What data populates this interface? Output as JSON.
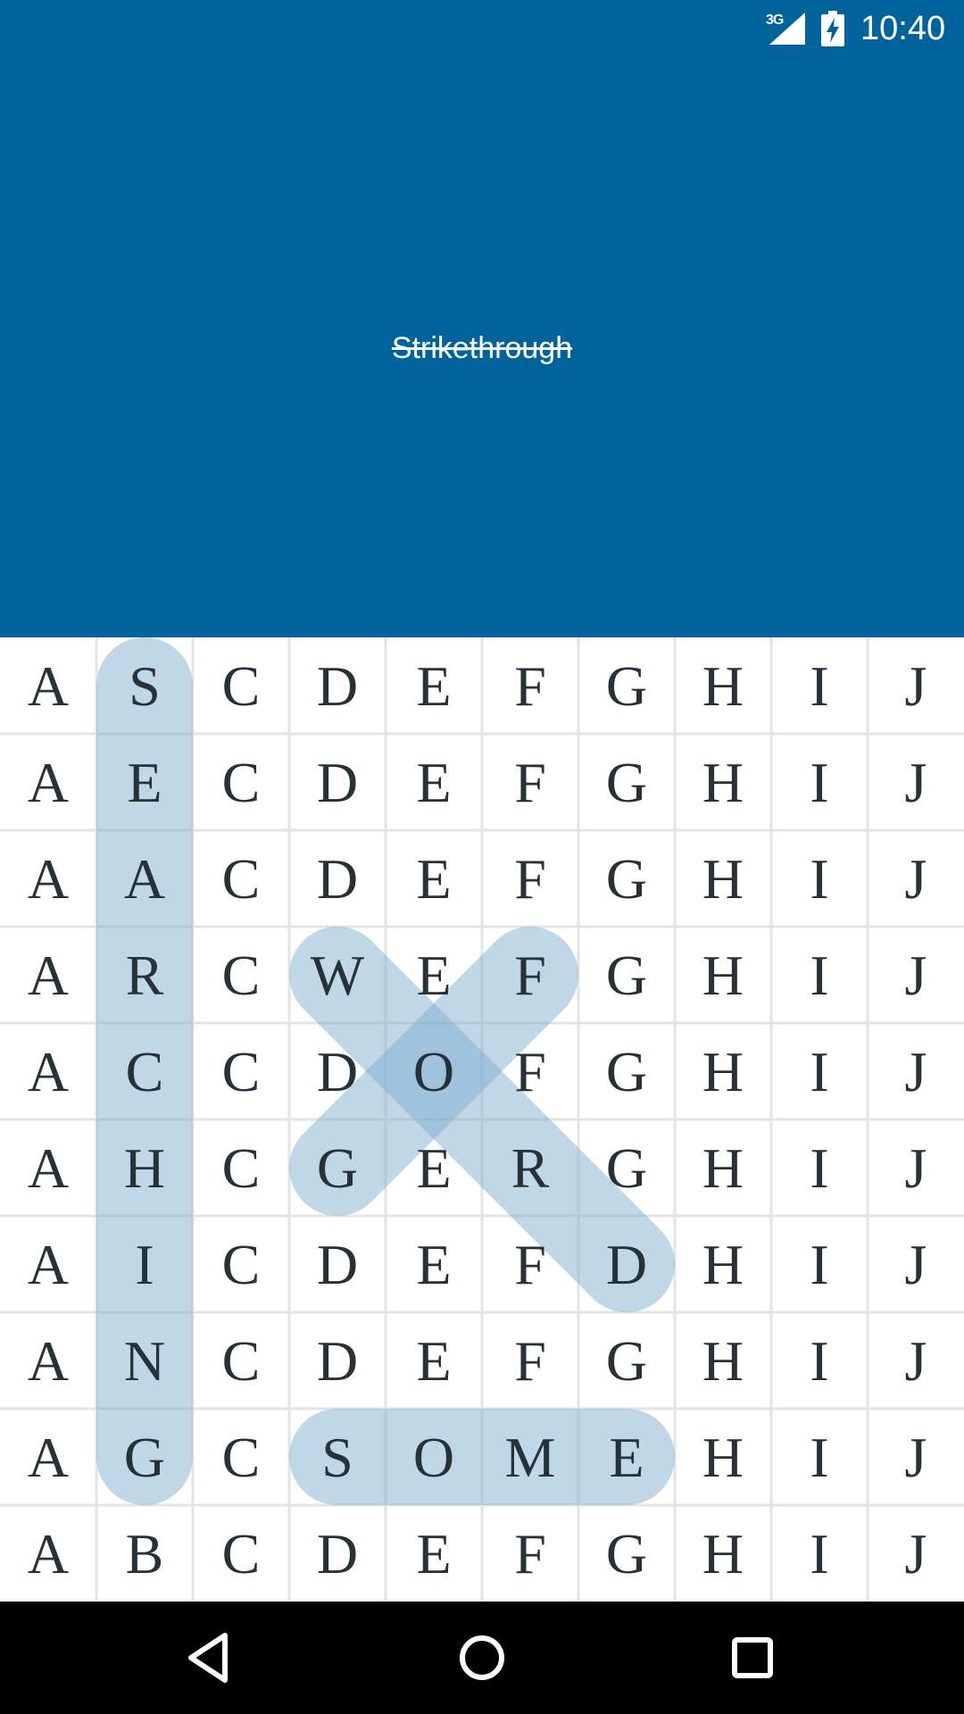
{
  "status_bar": {
    "network": "3G",
    "time": "10:40",
    "icons": [
      "signal-icon",
      "battery-charging-icon"
    ]
  },
  "header": {
    "found_word": "Strikethrough",
    "background_color": "#00639b"
  },
  "puzzle": {
    "rows": [
      [
        "A",
        "S",
        "C",
        "D",
        "E",
        "F",
        "G",
        "H",
        "I",
        "J"
      ],
      [
        "A",
        "E",
        "C",
        "D",
        "E",
        "F",
        "G",
        "H",
        "I",
        "J"
      ],
      [
        "A",
        "A",
        "C",
        "D",
        "E",
        "F",
        "G",
        "H",
        "I",
        "J"
      ],
      [
        "A",
        "R",
        "C",
        "W",
        "E",
        "F",
        "G",
        "H",
        "I",
        "J"
      ],
      [
        "A",
        "C",
        "C",
        "D",
        "O",
        "F",
        "G",
        "H",
        "I",
        "J"
      ],
      [
        "A",
        "H",
        "C",
        "G",
        "E",
        "R",
        "G",
        "H",
        "I",
        "J"
      ],
      [
        "A",
        "I",
        "C",
        "D",
        "E",
        "F",
        "D",
        "H",
        "I",
        "J"
      ],
      [
        "A",
        "N",
        "C",
        "D",
        "E",
        "F",
        "G",
        "H",
        "I",
        "J"
      ],
      [
        "A",
        "G",
        "C",
        "S",
        "O",
        "M",
        "E",
        "H",
        "I",
        "J"
      ],
      [
        "A",
        "B",
        "C",
        "D",
        "E",
        "F",
        "G",
        "H",
        "I",
        "J"
      ]
    ],
    "highlights": [
      {
        "word": "SEARCHING",
        "start": [
          0,
          1
        ],
        "end": [
          8,
          1
        ]
      },
      {
        "word": "WORD",
        "start": [
          3,
          3
        ],
        "end": [
          6,
          6
        ]
      },
      {
        "word": "FOG",
        "start": [
          3,
          5
        ],
        "end": [
          5,
          3
        ]
      },
      {
        "word": "SOME",
        "start": [
          8,
          3
        ],
        "end": [
          8,
          6
        ]
      }
    ],
    "highlight_color": "#7fb0cf",
    "letter_color": "#263238",
    "grid_line_color": "#e3e3e3"
  },
  "nav_bar": {
    "buttons": [
      "back-icon",
      "home-icon",
      "recents-icon"
    ]
  }
}
